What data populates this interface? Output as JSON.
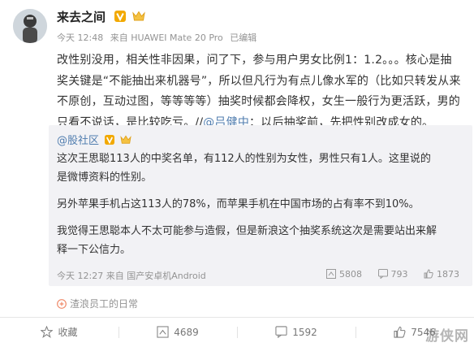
{
  "post": {
    "author": "来去之间",
    "time": "今天 12:48",
    "source": "来自 HUAWEI Mate 20 Pro",
    "edited": "已编辑",
    "text_segments": [
      {
        "text": "改性别没用，相关性非因果，问了下，参与用户男女比例1：1.2。。。核心是抽奖关键是“不能抽出来机器号”，所以但凡行为有点儿像水军的（比如只转发从来不原创，互动过图，等等等等）抽奖时候都会降权，女生一般行为更活跃，男的只看不说话，是比较吃亏。//",
        "style": "normal"
      },
      {
        "text": "@吕健中",
        "style": "link"
      },
      {
        "text": "：以后抽奖前，先把性别改成女的。",
        "style": "normal"
      }
    ]
  },
  "repost": {
    "author": "@股社区",
    "paragraphs": [
      "这次王思聪113人的中奖名单，有112人的性别为女性，男性只有1人。这里说的是微博资料的性别。",
      "另外苹果手机占这113人的78%，而苹果手机在中国市场的占有率不到10%。",
      "我觉得王思聪本人不太可能参与造假，但是新浪这个抽奖系统这次是需要站出来解释一下公信力。"
    ],
    "time": "今天 12:27",
    "source": "来自 国产安卓机Android",
    "reposts": "5808",
    "comments": "793",
    "likes": "1873"
  },
  "tagline": "渣浪员工的日常",
  "actions": {
    "favorite": "收藏",
    "repost": "4689",
    "comment": "1592",
    "like": "7546"
  },
  "watermark": "游侠网",
  "colors": {
    "link": "#507daf",
    "repost_bg": "#f2f2f5",
    "meta": "#939393",
    "vip_badge": "#f2a900"
  },
  "icons": {
    "vip_badge": "verified-v-icon",
    "member": "member-crown-icon",
    "favorite": "star-icon",
    "repost": "repost-icon",
    "comment": "comment-icon",
    "like": "thumbs-up-icon"
  }
}
